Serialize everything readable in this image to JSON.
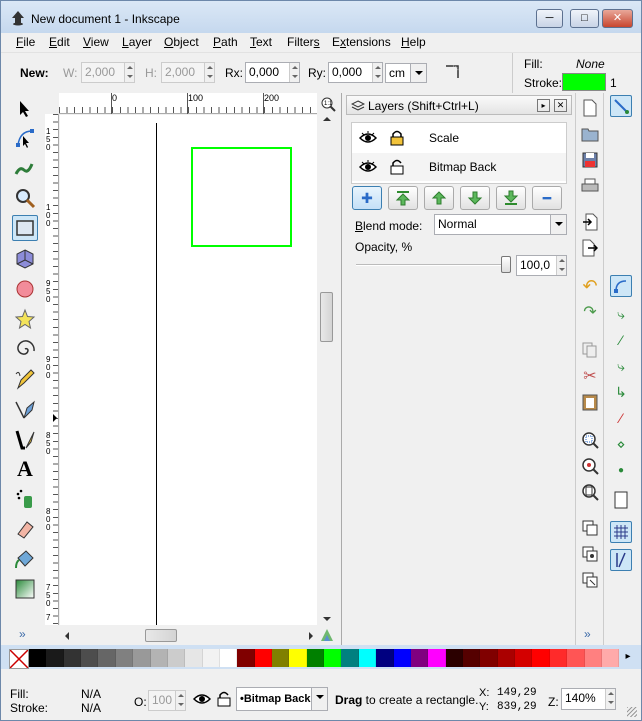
{
  "window": {
    "title": "New document 1 - Inkscape",
    "min": "─",
    "max": "□",
    "close": "✕"
  },
  "menu": [
    {
      "label": "File",
      "key": "F",
      "rest": "ile"
    },
    {
      "label": "Edit",
      "key": "E",
      "rest": "dit"
    },
    {
      "label": "View",
      "key": "V",
      "rest": "iew"
    },
    {
      "label": "Layer",
      "key": "L",
      "rest": "ayer"
    },
    {
      "label": "Object",
      "key": "O",
      "rest": "bject"
    },
    {
      "label": "Path",
      "key": "P",
      "rest": "ath"
    },
    {
      "label": "Text",
      "key": "T",
      "rest": "ext"
    },
    {
      "label": "Filters",
      "key": "s",
      "pre": "Filter",
      "rest": ""
    },
    {
      "label": "Extensions",
      "key": "x",
      "pre": "E",
      "rest": "tensions"
    },
    {
      "label": "Help",
      "key": "H",
      "rest": "elp"
    }
  ],
  "rect_toolbar": {
    "new_label": "New:",
    "w_label": "W:",
    "w_value": "2,000",
    "h_label": "H:",
    "h_value": "2,000",
    "rx_label": "Rx:",
    "rx_value": "0,000",
    "ry_label": "Ry:",
    "ry_value": "0,000",
    "unit": "cm"
  },
  "style_indicator": {
    "fill_label": "Fill:",
    "fill_value": "None",
    "stroke_label": "Stroke:",
    "stroke_color": "#00ff00",
    "stroke_width": "1"
  },
  "rulers": {
    "h_ticks": [
      "0",
      "100",
      "200"
    ],
    "v_ticks": [
      "1 5 0",
      "1 0 0",
      "9 5 0",
      "9 0 0",
      "8 5 0",
      "8 0 0",
      "7 5 0",
      "7"
    ]
  },
  "layers_panel": {
    "title": "Layers (Shift+Ctrl+L)",
    "layers": [
      {
        "name": "Scale",
        "locked": true
      },
      {
        "name": "Bitmap Back",
        "locked": false
      }
    ],
    "blend_label": "Blend mode:",
    "blend_key": "B",
    "blend_value": "Normal",
    "opacity_label": "Opacity, %",
    "opacity_value": "100,0",
    "opacity_level": 1.0
  },
  "palette": [
    "#000000",
    "#1a1a1a",
    "#333333",
    "#4d4d4d",
    "#666666",
    "#808080",
    "#999999",
    "#b3b3b3",
    "#cccccc",
    "#e6e6e6",
    "#f2f2f2",
    "#ffffff",
    "#800000",
    "#ff0000",
    "#808000",
    "#ffff00",
    "#008000",
    "#00ff00",
    "#008080",
    "#00ffff",
    "#000080",
    "#0000ff",
    "#800080",
    "#ff00ff",
    "#2b0000",
    "#550000",
    "#800000",
    "#aa0000",
    "#d40000",
    "#ff0000",
    "#ff2a2a",
    "#ff5555",
    "#ff8080",
    "#ffaaaa"
  ],
  "status": {
    "fill_label": "Fill:",
    "fill_value": "N/A",
    "stroke_label": "Stroke:",
    "stroke_value": "N/A",
    "o_label": "O:",
    "o_value": "100",
    "layer": "•Bitmap Back",
    "message_bold": "Drag",
    "message_rest": " to create a rectangle.",
    "x_label": "X:",
    "x_value": "149,29",
    "y_label": "Y:",
    "y_value": "839,29",
    "z_label": "Z:",
    "zoom": "140%"
  },
  "overflow": "»"
}
